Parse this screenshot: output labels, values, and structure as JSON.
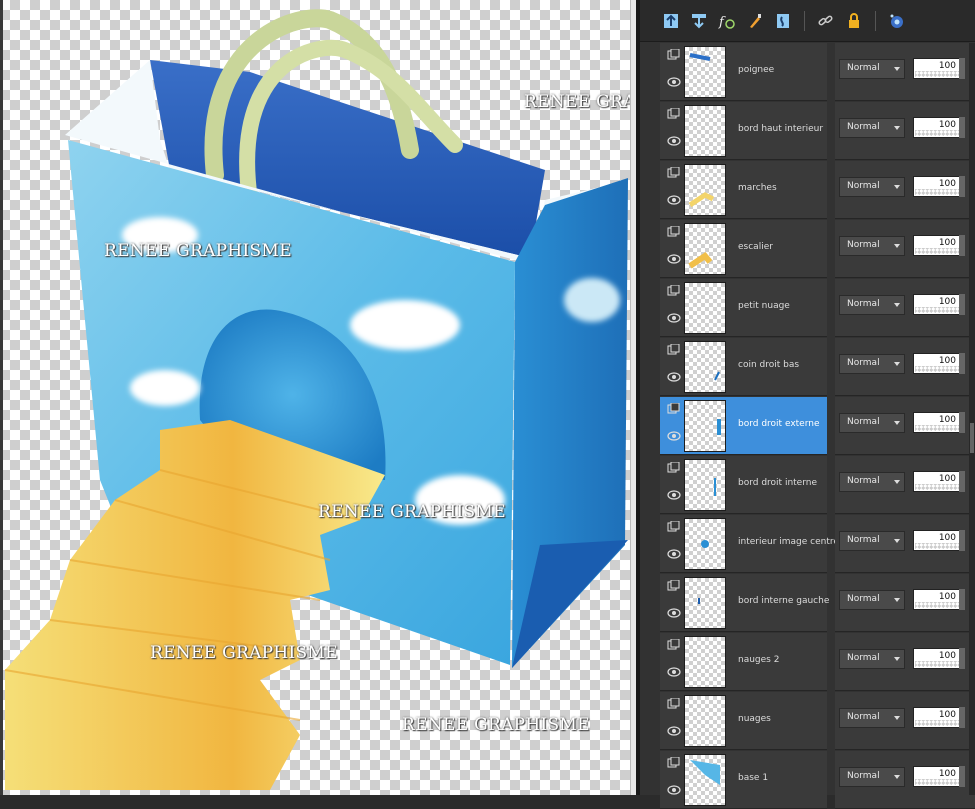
{
  "watermark": "RENEE GRAPHISME",
  "toolbar": {
    "icons": [
      "new-raster-layer-icon",
      "new-vector-layer-icon",
      "layer-fx-icon",
      "brush-icon",
      "mask-icon",
      "link-icon",
      "lock-icon",
      "visibility-toggle-icon"
    ]
  },
  "layers": [
    {
      "name": "poignee",
      "blend": "Normal",
      "opacity": "100",
      "selected": false
    },
    {
      "name": "bord haut interieur",
      "blend": "Normal",
      "opacity": "100",
      "selected": false
    },
    {
      "name": "marches",
      "blend": "Normal",
      "opacity": "100",
      "selected": false
    },
    {
      "name": "escalier",
      "blend": "Normal",
      "opacity": "100",
      "selected": false
    },
    {
      "name": "petit nuage",
      "blend": "Normal",
      "opacity": "100",
      "selected": false
    },
    {
      "name": "coin droit bas",
      "blend": "Normal",
      "opacity": "100",
      "selected": false
    },
    {
      "name": "bord droit externe",
      "blend": "Normal",
      "opacity": "100",
      "selected": true
    },
    {
      "name": "bord droit interne",
      "blend": "Normal",
      "opacity": "100",
      "selected": false
    },
    {
      "name": "interieur image centre",
      "blend": "Normal",
      "opacity": "100",
      "selected": false
    },
    {
      "name": "bord interne gauche",
      "blend": "Normal",
      "opacity": "100",
      "selected": false
    },
    {
      "name": "nauges 2",
      "blend": "Normal",
      "opacity": "100",
      "selected": false
    },
    {
      "name": "nuages",
      "blend": "Normal",
      "opacity": "100",
      "selected": false
    },
    {
      "name": "base 1",
      "blend": "Normal",
      "opacity": "100",
      "selected": false
    }
  ],
  "colors": {
    "accent": "#3e8fdc",
    "bag": "#56b6e6",
    "stairs": "#f6e27a"
  }
}
